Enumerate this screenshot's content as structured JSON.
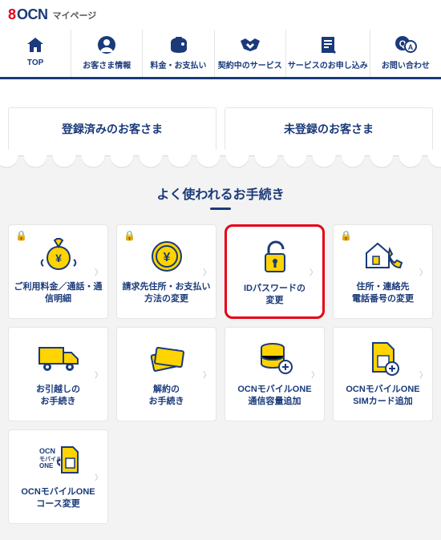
{
  "header": {
    "brand_mark": "8",
    "brand": "OCN",
    "page_name": "マイページ"
  },
  "nav": [
    {
      "label": "TOP",
      "icon": "home"
    },
    {
      "label": "お客さま情報",
      "icon": "user"
    },
    {
      "label": "料金・お支払い",
      "icon": "wallet"
    },
    {
      "label": "契約中のサービス",
      "icon": "handshake"
    },
    {
      "label": "サービスのお申し込み",
      "icon": "form"
    },
    {
      "label": "お問い合わせ",
      "icon": "qa"
    }
  ],
  "tabs": [
    {
      "label": "登録済みのお客さま"
    },
    {
      "label": "未登録のお客さま"
    }
  ],
  "section_title": "よく使われるお手続き",
  "cards": [
    {
      "label": "ご利用料金／通話・通\n信明細",
      "lock": true,
      "icon": "moneybag",
      "highlight": false
    },
    {
      "label": "請求先住所・お支払い\n方法の変更",
      "lock": true,
      "icon": "yen-coin",
      "highlight": false
    },
    {
      "label": "IDパスワードの\n変更",
      "lock": false,
      "icon": "padlock",
      "highlight": true
    },
    {
      "label": "住所・連絡先\n電話番号の変更",
      "lock": true,
      "icon": "house-phone",
      "highlight": false
    },
    {
      "label": "お引越しの\nお手続き",
      "lock": false,
      "icon": "truck",
      "highlight": false
    },
    {
      "label": "解約の\nお手続き",
      "lock": false,
      "icon": "tickets",
      "highlight": false
    },
    {
      "label": "OCNモバイルONE\n通信容量追加",
      "lock": false,
      "icon": "db-plus",
      "highlight": false
    },
    {
      "label": "OCNモバイルONE\nSIMカード追加",
      "lock": false,
      "icon": "sim-plus",
      "highlight": false
    },
    {
      "label": "OCNモバイルONE\nコース変更",
      "lock": false,
      "icon": "sim-swap",
      "highlight": false
    }
  ]
}
